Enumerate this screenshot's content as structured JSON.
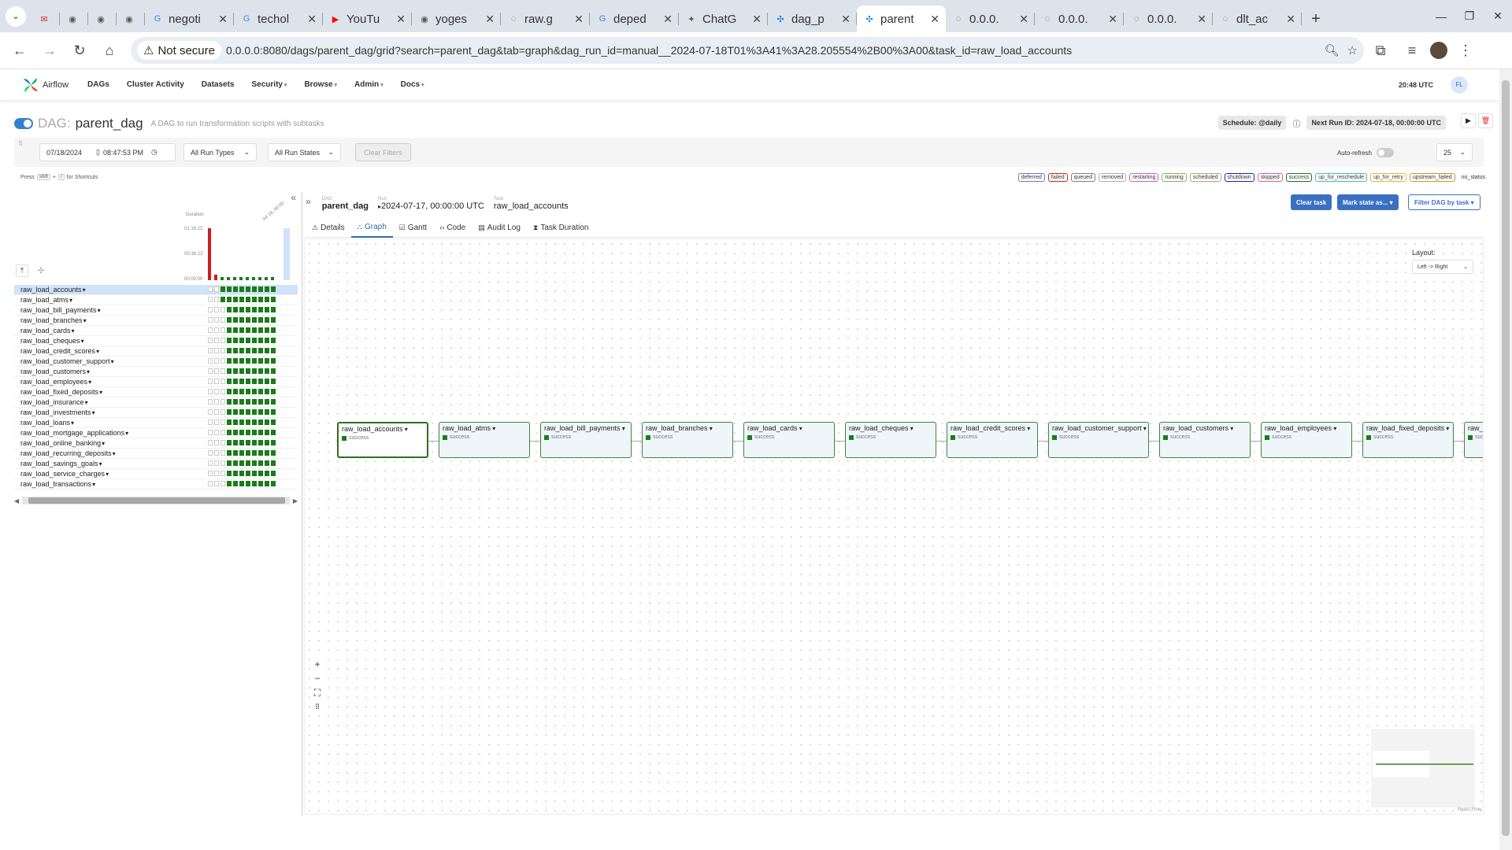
{
  "browser": {
    "tabs": [
      {
        "title": "",
        "icon": "gmail-icon",
        "active": false
      },
      {
        "title": "",
        "icon": "github-icon",
        "active": false
      },
      {
        "title": "",
        "icon": "github-icon",
        "active": false
      },
      {
        "title": "",
        "icon": "github-icon",
        "active": false
      },
      {
        "title": "negoti",
        "icon": "google-icon",
        "active": false
      },
      {
        "title": "techol",
        "icon": "google-icon",
        "active": false
      },
      {
        "title": "YouTu",
        "icon": "youtube-icon",
        "active": false
      },
      {
        "title": "yoges",
        "icon": "github-icon",
        "active": false
      },
      {
        "title": "raw.g",
        "icon": "globe-icon",
        "active": false
      },
      {
        "title": "deped",
        "icon": "google-icon",
        "active": false
      },
      {
        "title": "ChatG",
        "icon": "openai-icon",
        "active": false
      },
      {
        "title": "dag_p",
        "icon": "airflow-icon",
        "active": false
      },
      {
        "title": "parent",
        "icon": "airflow-icon",
        "active": true
      },
      {
        "title": "0.0.0.",
        "icon": "globe-icon",
        "active": false
      },
      {
        "title": "0.0.0.",
        "icon": "globe-icon",
        "active": false
      },
      {
        "title": "0.0.0.",
        "icon": "globe-icon",
        "active": false
      },
      {
        "title": "dlt_ac",
        "icon": "globe-icon",
        "active": false
      }
    ],
    "security_label": "Not secure",
    "url": "0.0.0.0:8080/dags/parent_dag/grid?search=parent_dag&tab=graph&dag_run_id=manual__2024-07-18T01%3A41%3A28.205554%2B00%3A00&task_id=raw_load_accounts"
  },
  "airflow_nav": {
    "brand": "Airflow",
    "menu": [
      {
        "label": "DAGs",
        "dropdown": false
      },
      {
        "label": "Cluster Activity",
        "dropdown": false
      },
      {
        "label": "Datasets",
        "dropdown": false
      },
      {
        "label": "Security",
        "dropdown": true
      },
      {
        "label": "Browse",
        "dropdown": true
      },
      {
        "label": "Admin",
        "dropdown": true
      },
      {
        "label": "Docs",
        "dropdown": true
      }
    ],
    "time": "20:48 UTC",
    "user_initials": "FL"
  },
  "dag": {
    "prefix": "DAG:",
    "name": "parent_dag",
    "description": "A DAG to run transformation scripts with subtasks",
    "schedule": "Schedule: @daily",
    "next_run": "Next Run ID: 2024-07-18, 00:00:00 UTC"
  },
  "filters": {
    "date": "07/18/2024",
    "time": "08:47:53 PM",
    "run_types": "All Run Types",
    "run_states": "All Run States",
    "clear_label": "Clear Filters",
    "auto_refresh_label": "Auto-refresh",
    "num_runs": "25"
  },
  "shortcuts": {
    "press": "Press",
    "key1": "shift",
    "plus": "+",
    "key2": "/",
    "suffix": "for Shortcuts"
  },
  "legend": [
    {
      "label": "deferred",
      "color": "#7c6fd0"
    },
    {
      "label": "failed",
      "color": "#e02020"
    },
    {
      "label": "queued",
      "color": "#808080"
    },
    {
      "label": "removed",
      "color": "#b0b0b0"
    },
    {
      "label": "restarting",
      "color": "#d060d0"
    },
    {
      "label": "running",
      "color": "#7cc048"
    },
    {
      "label": "scheduled",
      "color": "#c0a080"
    },
    {
      "label": "shutdown",
      "color": "#2020c0"
    },
    {
      "label": "skipped",
      "color": "#e060a0"
    },
    {
      "label": "success",
      "color": "#1a7c1a"
    },
    {
      "label": "up_for_reschedule",
      "color": "#40c0c0"
    },
    {
      "label": "up_for_retry",
      "color": "#e0c020"
    },
    {
      "label": "upstream_failed",
      "color": "#e09020"
    },
    {
      "label": "no_status",
      "color": "#ffffff"
    }
  ],
  "grid": {
    "duration_label": "Duration",
    "ticks": [
      "01:18:22",
      "00:38:13",
      "00:00:00"
    ],
    "date_tick": "Jul 18, 00:00",
    "durations_min": [
      78,
      8,
      2,
      2,
      2,
      2,
      2,
      2,
      2,
      2,
      2
    ],
    "tasks": [
      "raw_load_accounts",
      "raw_load_atms",
      "raw_load_bill_payments",
      "raw_load_branches",
      "raw_load_cards",
      "raw_load_cheques",
      "raw_load_credit_scores",
      "raw_load_customer_support",
      "raw_load_customers",
      "raw_load_employees",
      "raw_load_fixed_deposits",
      "raw_load_insurance",
      "raw_load_investments",
      "raw_load_loans",
      "raw_load_mortgage_applications",
      "raw_load_online_banking",
      "raw_load_recurring_deposits",
      "raw_load_savings_goals",
      "raw_load_service_charges",
      "raw_load_transactions"
    ]
  },
  "breadcrumb": {
    "dag_label": "DAG",
    "dag": "parent_dag",
    "run_label": "Run",
    "run": "2024-07-17, 00:00:00 UTC",
    "task_label": "Task",
    "task": "raw_load_accounts"
  },
  "actions": {
    "clear": "Clear task",
    "mark": "Mark state as...",
    "filter": "Filter DAG by task"
  },
  "detail_tabs": [
    {
      "label": "Details",
      "icon": "warning-icon"
    },
    {
      "label": "Graph",
      "icon": "graph-icon"
    },
    {
      "label": "Gantt",
      "icon": "gantt-icon"
    },
    {
      "label": "Code",
      "icon": "code-icon"
    },
    {
      "label": "Audit Log",
      "icon": "log-icon"
    },
    {
      "label": "Task Duration",
      "icon": "hourglass-icon"
    }
  ],
  "graph": {
    "layout_label": "Layout:",
    "layout_value": "Left -> Right",
    "nodes": [
      {
        "name": "raw_load_accounts",
        "state": "success"
      },
      {
        "name": "raw_load_atms",
        "state": "success"
      },
      {
        "name": "raw_load_bill_payments",
        "state": "success"
      },
      {
        "name": "raw_load_branches",
        "state": "success"
      },
      {
        "name": "raw_load_cards",
        "state": "success"
      },
      {
        "name": "raw_load_cheques",
        "state": "success"
      },
      {
        "name": "raw_load_credit_scores",
        "state": "success"
      },
      {
        "name": "raw_load_customer_support",
        "state": "success"
      },
      {
        "name": "raw_load_customers",
        "state": "success"
      },
      {
        "name": "raw_load_employees",
        "state": "success"
      },
      {
        "name": "raw_load_fixed_deposits",
        "state": "success"
      },
      {
        "name": "raw_load_loa",
        "state": "success"
      }
    ],
    "attribution": "React Flow"
  }
}
